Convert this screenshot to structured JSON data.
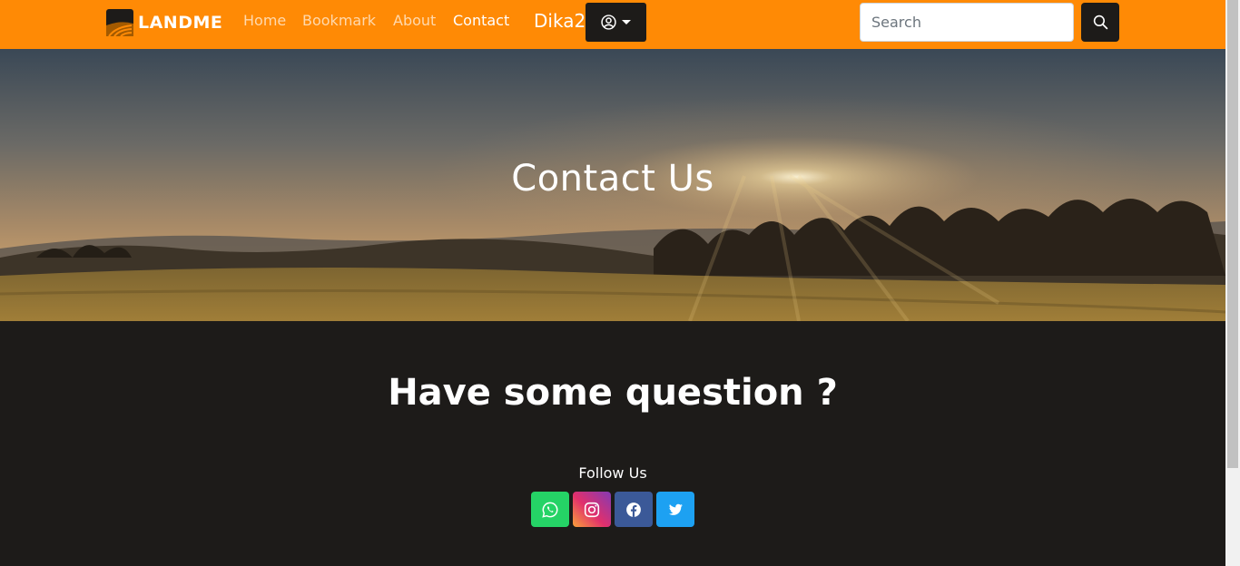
{
  "navbar": {
    "brand": "LANDME",
    "links": [
      {
        "label": "Home",
        "active": false
      },
      {
        "label": "Bookmark",
        "active": false
      },
      {
        "label": "About",
        "active": false
      },
      {
        "label": "Contact",
        "active": true
      }
    ],
    "username": "Dika2",
    "user_menu_icon": "user-circle-icon",
    "search": {
      "placeholder": "Search",
      "value": ""
    },
    "search_icon": "search-icon"
  },
  "hero": {
    "title": "Contact Us"
  },
  "main": {
    "heading": "Have some question ?",
    "follow_label": "Follow Us",
    "social": [
      {
        "name": "whatsapp",
        "icon": "whatsapp-icon",
        "color": "#25d366"
      },
      {
        "name": "instagram",
        "icon": "instagram-icon",
        "color": "#e1306c"
      },
      {
        "name": "facebook",
        "icon": "facebook-icon",
        "color": "#3b5998"
      },
      {
        "name": "twitter",
        "icon": "twitter-icon",
        "color": "#1da1f2"
      }
    ]
  },
  "colors": {
    "accent": "#ff8a05",
    "dark": "#1d1b19"
  }
}
